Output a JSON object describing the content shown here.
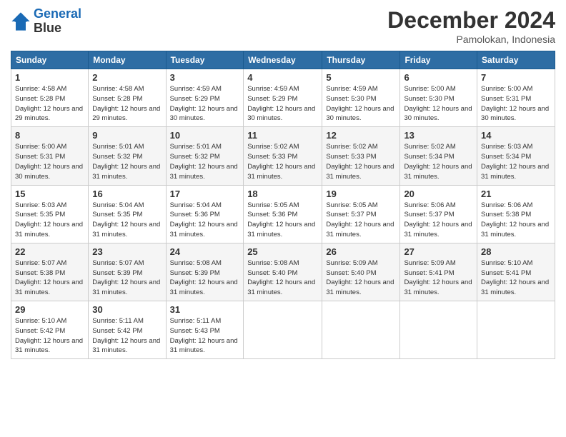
{
  "logo": {
    "line1": "General",
    "line2": "Blue"
  },
  "title": "December 2024",
  "location": "Pamolokan, Indonesia",
  "days_header": [
    "Sunday",
    "Monday",
    "Tuesday",
    "Wednesday",
    "Thursday",
    "Friday",
    "Saturday"
  ],
  "weeks": [
    [
      {
        "day": "1",
        "sunrise": "4:58 AM",
        "sunset": "5:28 PM",
        "daylight": "12 hours and 29 minutes."
      },
      {
        "day": "2",
        "sunrise": "4:58 AM",
        "sunset": "5:28 PM",
        "daylight": "12 hours and 29 minutes."
      },
      {
        "day": "3",
        "sunrise": "4:59 AM",
        "sunset": "5:29 PM",
        "daylight": "12 hours and 30 minutes."
      },
      {
        "day": "4",
        "sunrise": "4:59 AM",
        "sunset": "5:29 PM",
        "daylight": "12 hours and 30 minutes."
      },
      {
        "day": "5",
        "sunrise": "4:59 AM",
        "sunset": "5:30 PM",
        "daylight": "12 hours and 30 minutes."
      },
      {
        "day": "6",
        "sunrise": "5:00 AM",
        "sunset": "5:30 PM",
        "daylight": "12 hours and 30 minutes."
      },
      {
        "day": "7",
        "sunrise": "5:00 AM",
        "sunset": "5:31 PM",
        "daylight": "12 hours and 30 minutes."
      }
    ],
    [
      {
        "day": "8",
        "sunrise": "5:00 AM",
        "sunset": "5:31 PM",
        "daylight": "12 hours and 30 minutes."
      },
      {
        "day": "9",
        "sunrise": "5:01 AM",
        "sunset": "5:32 PM",
        "daylight": "12 hours and 31 minutes."
      },
      {
        "day": "10",
        "sunrise": "5:01 AM",
        "sunset": "5:32 PM",
        "daylight": "12 hours and 31 minutes."
      },
      {
        "day": "11",
        "sunrise": "5:02 AM",
        "sunset": "5:33 PM",
        "daylight": "12 hours and 31 minutes."
      },
      {
        "day": "12",
        "sunrise": "5:02 AM",
        "sunset": "5:33 PM",
        "daylight": "12 hours and 31 minutes."
      },
      {
        "day": "13",
        "sunrise": "5:02 AM",
        "sunset": "5:34 PM",
        "daylight": "12 hours and 31 minutes."
      },
      {
        "day": "14",
        "sunrise": "5:03 AM",
        "sunset": "5:34 PM",
        "daylight": "12 hours and 31 minutes."
      }
    ],
    [
      {
        "day": "15",
        "sunrise": "5:03 AM",
        "sunset": "5:35 PM",
        "daylight": "12 hours and 31 minutes."
      },
      {
        "day": "16",
        "sunrise": "5:04 AM",
        "sunset": "5:35 PM",
        "daylight": "12 hours and 31 minutes."
      },
      {
        "day": "17",
        "sunrise": "5:04 AM",
        "sunset": "5:36 PM",
        "daylight": "12 hours and 31 minutes."
      },
      {
        "day": "18",
        "sunrise": "5:05 AM",
        "sunset": "5:36 PM",
        "daylight": "12 hours and 31 minutes."
      },
      {
        "day": "19",
        "sunrise": "5:05 AM",
        "sunset": "5:37 PM",
        "daylight": "12 hours and 31 minutes."
      },
      {
        "day": "20",
        "sunrise": "5:06 AM",
        "sunset": "5:37 PM",
        "daylight": "12 hours and 31 minutes."
      },
      {
        "day": "21",
        "sunrise": "5:06 AM",
        "sunset": "5:38 PM",
        "daylight": "12 hours and 31 minutes."
      }
    ],
    [
      {
        "day": "22",
        "sunrise": "5:07 AM",
        "sunset": "5:38 PM",
        "daylight": "12 hours and 31 minutes."
      },
      {
        "day": "23",
        "sunrise": "5:07 AM",
        "sunset": "5:39 PM",
        "daylight": "12 hours and 31 minutes."
      },
      {
        "day": "24",
        "sunrise": "5:08 AM",
        "sunset": "5:39 PM",
        "daylight": "12 hours and 31 minutes."
      },
      {
        "day": "25",
        "sunrise": "5:08 AM",
        "sunset": "5:40 PM",
        "daylight": "12 hours and 31 minutes."
      },
      {
        "day": "26",
        "sunrise": "5:09 AM",
        "sunset": "5:40 PM",
        "daylight": "12 hours and 31 minutes."
      },
      {
        "day": "27",
        "sunrise": "5:09 AM",
        "sunset": "5:41 PM",
        "daylight": "12 hours and 31 minutes."
      },
      {
        "day": "28",
        "sunrise": "5:10 AM",
        "sunset": "5:41 PM",
        "daylight": "12 hours and 31 minutes."
      }
    ],
    [
      {
        "day": "29",
        "sunrise": "5:10 AM",
        "sunset": "5:42 PM",
        "daylight": "12 hours and 31 minutes."
      },
      {
        "day": "30",
        "sunrise": "5:11 AM",
        "sunset": "5:42 PM",
        "daylight": "12 hours and 31 minutes."
      },
      {
        "day": "31",
        "sunrise": "5:11 AM",
        "sunset": "5:43 PM",
        "daylight": "12 hours and 31 minutes."
      },
      null,
      null,
      null,
      null
    ]
  ]
}
